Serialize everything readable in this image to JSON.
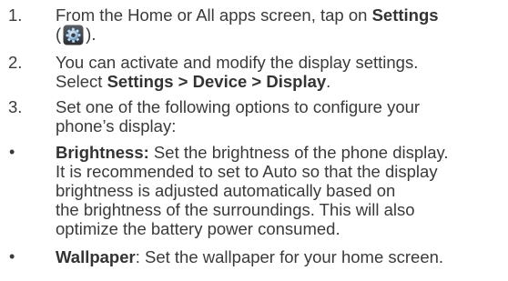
{
  "steps": [
    {
      "marker": "1.",
      "line1_text": "From the Home or All apps screen, tap on ",
      "line1_bold": "Settings",
      "line2_open": "(",
      "icon": "settings-gear-icon",
      "line2_close": ")."
    },
    {
      "marker": "2.",
      "line1": "You can activate and modify the display settings.",
      "line2_text": "Select ",
      "line2_bold": "Settings > Device > Display",
      "line2_end": "."
    },
    {
      "marker": "3.",
      "line1": "Set one of the following options to configure your",
      "line2": "phone’s display:"
    }
  ],
  "bullets": [
    {
      "marker": "•",
      "term": "Brightness:",
      "lines": [
        " Set the brightness of the phone display.",
        "It is recommended to set to Auto so that the display",
        "brightness is adjusted automatically based on",
        "the brightness of the surroundings. This will also",
        "optimize the battery power consumed."
      ]
    },
    {
      "marker": "•",
      "term": "Wallpaper",
      "rest": ": Set the wallpaper for your home screen."
    }
  ],
  "colors": {
    "text": "#3a3a3a"
  }
}
